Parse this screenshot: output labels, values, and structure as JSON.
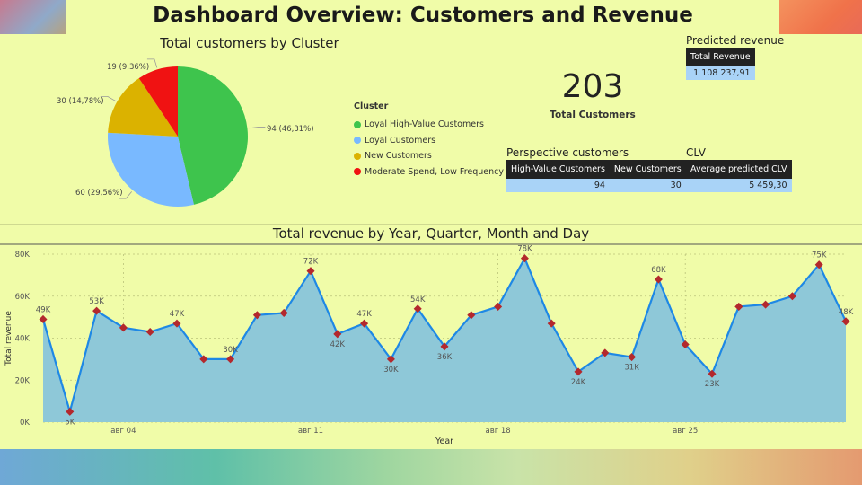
{
  "header": {
    "title": "Dashboard Overview: Customers and Revenue"
  },
  "pie": {
    "title": "Total customers by Cluster",
    "legend_title": "Cluster",
    "slices": [
      {
        "name": "Loyal High-Value Customers",
        "value": 94,
        "label": "94 (46,31%)",
        "color": "#3ec44d"
      },
      {
        "name": "Loyal Customers",
        "value": 60,
        "label": "60 (29,56%)",
        "color": "#79b9ff"
      },
      {
        "name": "New Customers",
        "value": 30,
        "label": "30 (14,78%)",
        "color": "#dbb200"
      },
      {
        "name": "Moderate Spend, Low Frequency",
        "value": 19,
        "label": "19 (9,36%)",
        "color": "#f01212"
      }
    ]
  },
  "kpi": {
    "value": "203",
    "label": "Total Customers"
  },
  "predicted_revenue": {
    "title": "Predicted revenue",
    "header": "Total Revenue",
    "value": "1 108 237,91"
  },
  "perspective": {
    "title": "Perspective customers",
    "headers": [
      "High-Value Customers",
      "New Customers"
    ],
    "values": [
      "94",
      "30"
    ]
  },
  "clv": {
    "title": "CLV",
    "header": "Average predicted CLV",
    "value": "5 459,30"
  },
  "chart_data": {
    "type": "area",
    "title": "Total revenue by Year, Quarter, Month and Day",
    "xlabel": "Year",
    "ylabel": "Total revenue",
    "ylim": [
      0,
      80000
    ],
    "yticks": [
      "0K",
      "20K",
      "40K",
      "60K",
      "80K"
    ],
    "xticks": [
      "авг 04",
      "авг 11",
      "авг 18",
      "авг 25"
    ],
    "xtick_index": [
      3,
      10,
      17,
      24
    ],
    "grid": true,
    "line_color": "#1e88e5",
    "fill_color": "#8ec8d8",
    "marker_color": "#b3282d",
    "values": [
      49000,
      5000,
      53000,
      45000,
      43000,
      47000,
      30000,
      30000,
      51000,
      52000,
      72000,
      42000,
      47000,
      30000,
      54000,
      36000,
      51000,
      55000,
      78000,
      47000,
      24000,
      33000,
      31000,
      68000,
      37000,
      23000,
      55000,
      56000,
      60000,
      75000,
      48000
    ],
    "labels": [
      "49K",
      "5K",
      "53K",
      "",
      "",
      "47K",
      "",
      "30K",
      "",
      "",
      "72K",
      "42K",
      "47K",
      "30K",
      "54K",
      "36K",
      "",
      "",
      "78K",
      "",
      "24K",
      "",
      "31K",
      "68K",
      "",
      "23K",
      "",
      "",
      "",
      "75K",
      "48K"
    ]
  }
}
